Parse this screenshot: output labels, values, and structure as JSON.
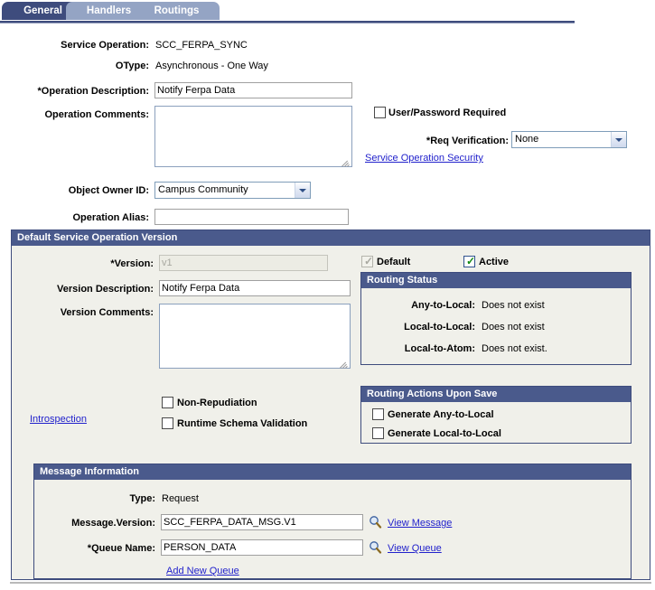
{
  "tabs": [
    {
      "label": "General",
      "active": true
    },
    {
      "label": "Handlers",
      "active": false
    },
    {
      "label": "Routings",
      "active": false
    }
  ],
  "general": {
    "service_operation_label": "Service Operation:",
    "service_operation_value": "SCC_FERPA_SYNC",
    "otype_label": "OType:",
    "otype_value": "Asynchronous - One Way",
    "operation_description_label": "*Operation Description:",
    "operation_description_value": "Notify Ferpa Data",
    "operation_comments_label": "Operation Comments:",
    "operation_comments_value": "",
    "user_password_required_label": "User/Password Required",
    "user_password_required_checked": false,
    "req_verification_label": "*Req Verification:",
    "req_verification_value": "None",
    "service_operation_security_link": "Service Operation Security",
    "object_owner_id_label": "Object Owner ID:",
    "object_owner_id_value": "Campus Community",
    "operation_alias_label": "Operation Alias:",
    "operation_alias_value": ""
  },
  "default_version": {
    "title": "Default Service Operation Version",
    "version_label": "*Version:",
    "version_value": "v1",
    "version_disabled": true,
    "version_description_label": "Version Description:",
    "version_description_value": "Notify Ferpa Data",
    "version_comments_label": "Version Comments:",
    "version_comments_value": "",
    "default_checkbox_label": "Default",
    "default_checked": true,
    "active_checkbox_label": "Active",
    "active_checked": true,
    "non_repudiation_label": "Non-Repudiation",
    "non_repudiation_checked": false,
    "runtime_schema_validation_label": "Runtime Schema Validation",
    "runtime_schema_validation_checked": false,
    "introspection_link": "Introspection"
  },
  "routing_status": {
    "title": "Routing Status",
    "rows": [
      {
        "label": "Any-to-Local:",
        "value": "Does not exist"
      },
      {
        "label": "Local-to-Local:",
        "value": "Does not exist"
      },
      {
        "label": "Local-to-Atom:",
        "value": "Does not exist."
      }
    ]
  },
  "routing_actions": {
    "title": "Routing Actions Upon Save",
    "items": [
      {
        "label": "Generate Any-to-Local",
        "checked": false
      },
      {
        "label": "Generate Local-to-Local",
        "checked": false
      }
    ]
  },
  "message_information": {
    "title": "Message Information",
    "type_label": "Type:",
    "type_value": "Request",
    "message_version_label": "Message.Version:",
    "message_version_value": "SCC_FERPA_DATA_MSG.V1",
    "view_message_link": "View Message",
    "queue_name_label": "*Queue Name:",
    "queue_name_value": "PERSON_DATA",
    "view_queue_link": "View Queue",
    "add_new_queue_link": "Add New Queue",
    "lookup_icon": "magnifier-icon"
  }
}
